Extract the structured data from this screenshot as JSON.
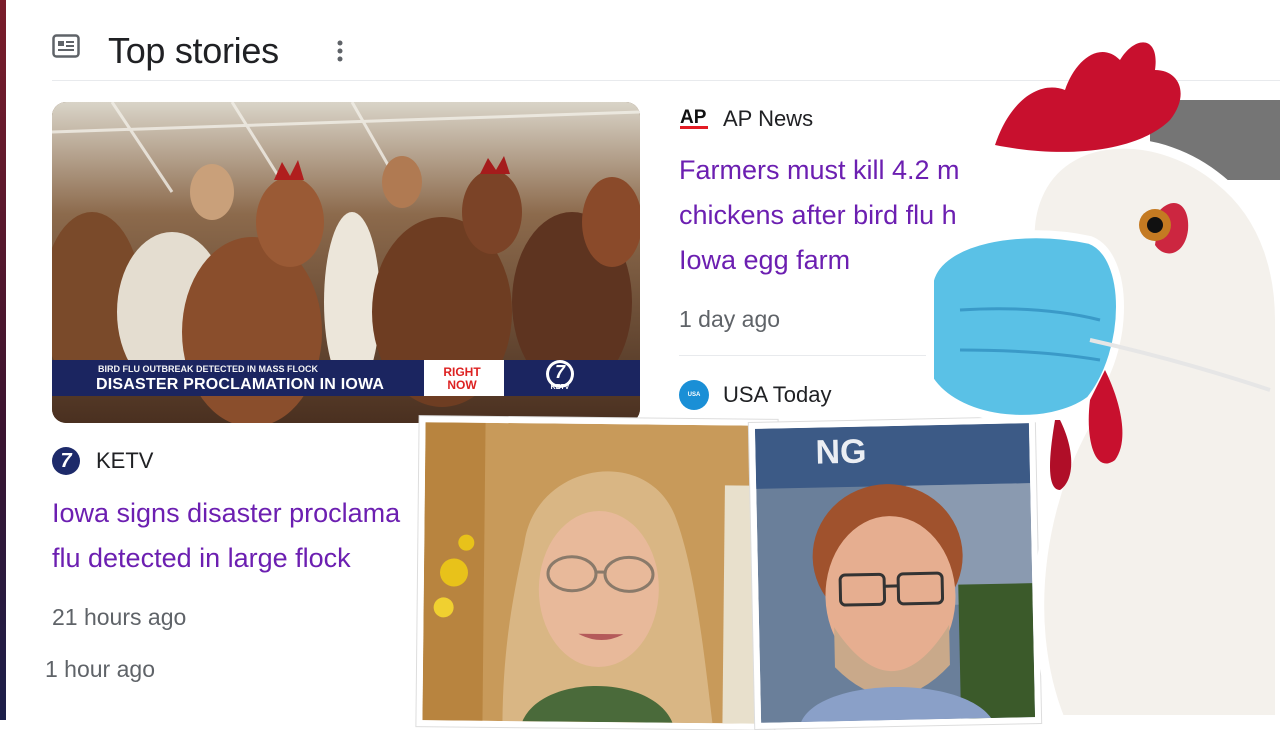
{
  "header": {
    "title": "Top stories",
    "news_icon": "news-icon",
    "more_icon": "more-vert-icon"
  },
  "lead_story": {
    "chyron": {
      "sub": "BIRD FLU OUTBREAK DETECTED IN MASS FLOCK",
      "main": "DISASTER PROCLAMATION IN IOWA",
      "tag_line1": "RIGHT",
      "tag_line2": "NOW",
      "logo_text": "7",
      "logo_caption": "KETV"
    },
    "source": "KETV",
    "source_logo_text": "7",
    "headline_line1": "Iowa signs disaster proclama",
    "headline_line2": "flu detected in large flock",
    "time": "21 hours ago",
    "extra_time": "1 hour ago"
  },
  "side_story": {
    "source": "AP News",
    "source_logo_text": "AP",
    "headline_line1": "Farmers must kill 4.2 m",
    "headline_line2": "chickens after bird flu h",
    "headline_line3": "Iowa egg farm",
    "time": "1 day ago"
  },
  "next_story": {
    "source": "USA Today",
    "source_logo_text": "USA TODAY"
  },
  "overlay": {
    "banner_text": "NG"
  },
  "colors": {
    "headline": "#6c1fb1",
    "meta": "#5f6368",
    "title": "#202124"
  }
}
